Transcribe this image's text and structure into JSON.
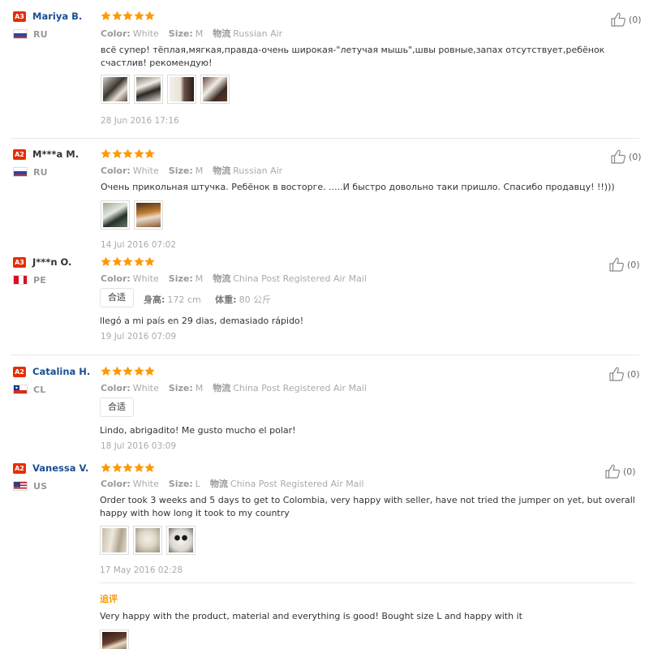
{
  "colors": {
    "star": "#ff9900",
    "level_badge": "#e62e04",
    "name_link": "#1b4f93",
    "followup": "#ff9900"
  },
  "labels": {
    "color": "Color:",
    "size": "Size:",
    "shipping": "物流",
    "height": "身高:",
    "weight": "体重:",
    "fit": "合适",
    "followup": "追评"
  },
  "reviews": [
    {
      "level": "A3",
      "name": "Mariya B.",
      "country": "RU",
      "stars": 5,
      "likes": "(0)",
      "color": "White",
      "size": "M",
      "shipping": "Russian Air",
      "text": "всё супер! тёплая,мягкая,правда-очень широкая-\"летучая мышь\",швы ровные,запах отсутствует,ребёнок счастлив! рекомендую!",
      "photos": 4,
      "date": "28 Jun 2016 17:16"
    },
    {
      "level": "A2",
      "name": "M***a M.",
      "country": "RU",
      "stars": 5,
      "likes": "(0)",
      "color": "White",
      "size": "M",
      "shipping": "Russian Air",
      "text": "Очень прикольная штучка. Ребёнок в восторге. .....И быстро довольно таки пришло. Спасибо продавцу! !!)))",
      "photos": 2,
      "date": "14 Jul 2016 07:02"
    },
    {
      "level": "A3",
      "name": "J***n O.",
      "country": "PE",
      "stars": 5,
      "likes": "(0)",
      "color": "White",
      "size": "M",
      "shipping": "China Post Registered Air Mail",
      "fit": "合适",
      "height": "172 cm",
      "weight": "80 公斤",
      "text": "llegó a mi país en 29 dias, demasiado rápido!",
      "date": "19 Jul 2016 07:09"
    },
    {
      "level": "A2",
      "name": "Catalina H.",
      "country": "CL",
      "stars": 5,
      "likes": "(0)",
      "color": "White",
      "size": "M",
      "shipping": "China Post Registered Air Mail",
      "fit": "合适",
      "text": "Lindo, abrigadito! Me gusto mucho el polar!",
      "date": "18 Jul 2016 03:09"
    },
    {
      "level": "A2",
      "name": "Vanessa V.",
      "country": "US",
      "stars": 5,
      "likes": "(0)",
      "color": "White",
      "size": "L",
      "shipping": "China Post Registered Air Mail",
      "text": "Order took 3 weeks and 5 days to get to Colombia, very happy with seller, have not tried the jumper on yet, but overall happy with how long it took to my country",
      "photos": 3,
      "date": "17 May 2016 02:28",
      "followup_text": "Very happy with the product, material and everything is good! Bought size L and happy with it"
    }
  ]
}
